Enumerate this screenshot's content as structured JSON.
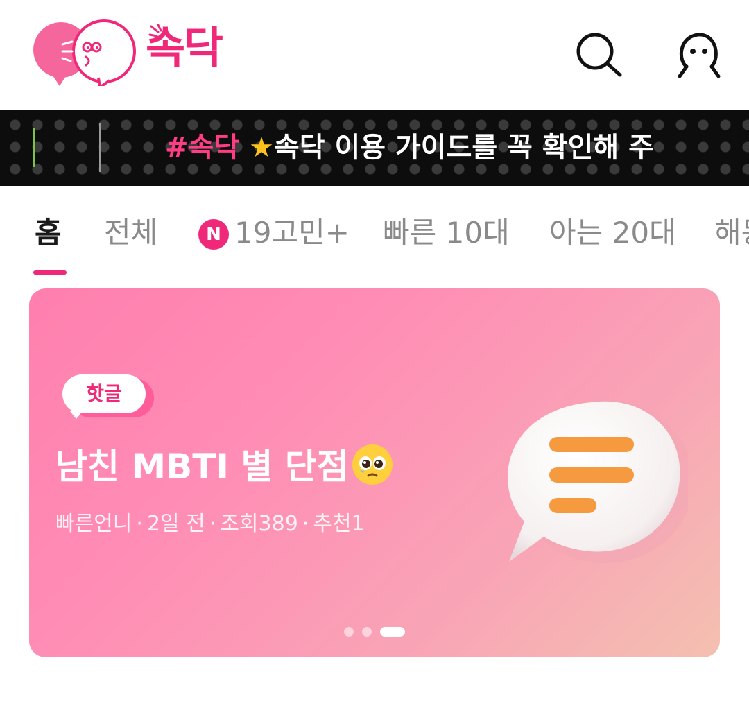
{
  "header": {
    "logo_text": "속닥",
    "icons": {
      "search": "search-icon",
      "profile": "profile-icon"
    },
    "brand_color": "#f0287a"
  },
  "ticker": {
    "tag": "#속닥",
    "star_icon": "star-icon",
    "message": "속닥 이용 가이드를 꼭 확인해 주"
  },
  "tabs": {
    "items": [
      {
        "label": "홈",
        "active": true
      },
      {
        "label": "전체",
        "active": false
      },
      {
        "label": "19고민+",
        "badge": "N",
        "active": false
      },
      {
        "label": "빠른 10대",
        "active": false
      },
      {
        "label": "아는 20대",
        "active": false
      },
      {
        "label": "해몽",
        "active": false
      }
    ]
  },
  "banner": {
    "badge": "핫글",
    "title": "남친 MBTI 별 단점",
    "title_emoji": "pleading-face-emoji",
    "meta": {
      "author": "빠른언니",
      "time": "2일 전",
      "views": "조회389",
      "likes": "추천1"
    },
    "illustration": "speech-bubble-icon",
    "pagination": {
      "count": 3,
      "active_index": 3
    }
  }
}
